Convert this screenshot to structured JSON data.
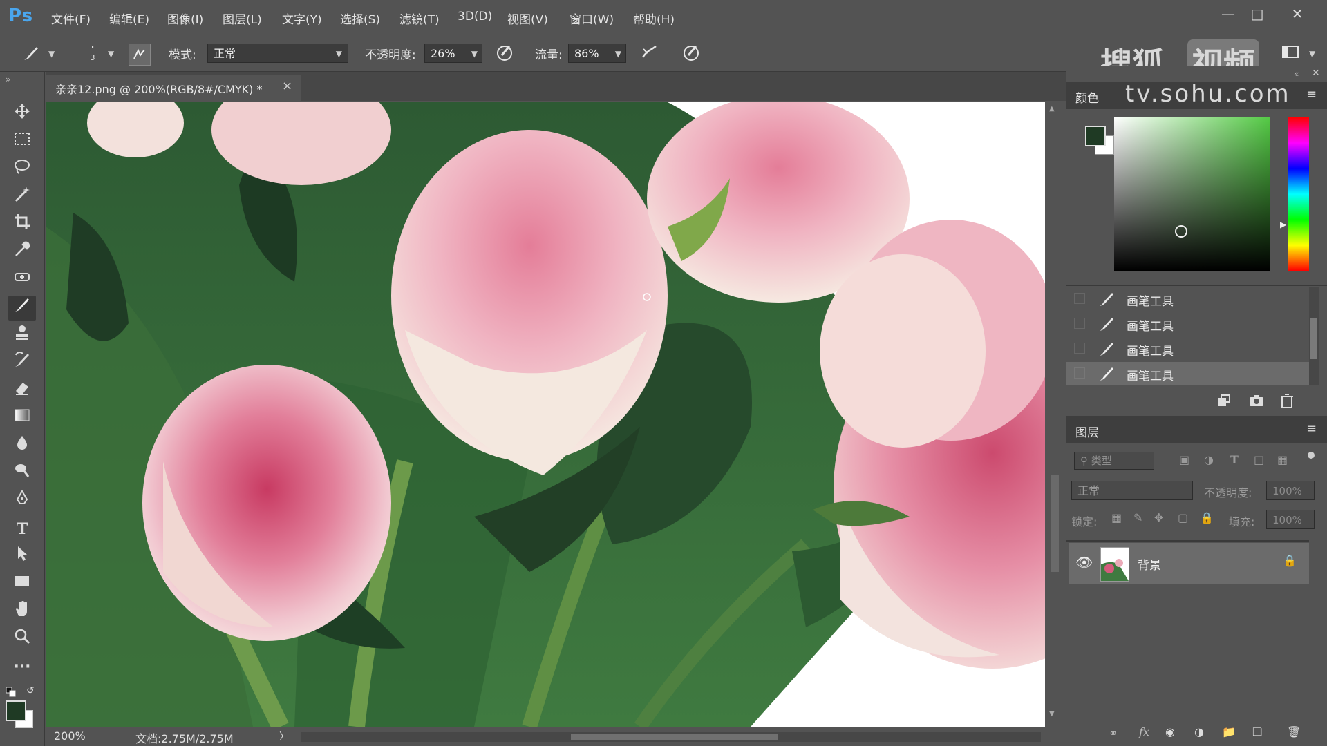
{
  "app": {
    "logo": "Ps"
  },
  "menu": [
    "文件(F)",
    "编辑(E)",
    "图像(I)",
    "图层(L)",
    "文字(Y)",
    "选择(S)",
    "滤镜(T)",
    "3D(D)",
    "视图(V)",
    "窗口(W)",
    "帮助(H)"
  ],
  "options": {
    "brush_size": "3",
    "mode_label": "模式:",
    "mode_value": "正常",
    "opacity_label": "不透明度:",
    "opacity_value": "26%",
    "flow_label": "流量:",
    "flow_value": "86%"
  },
  "watermark": {
    "brand": "搜狐",
    "video": "视频",
    "url": "tv.sohu.com"
  },
  "document": {
    "tab_title": "亲亲12.png @ 200%(RGB/8#/CMYK) *",
    "close": "×"
  },
  "status": {
    "zoom": "200%",
    "doc_size": "文档:2.75M/2.75M",
    "arrow": "〉"
  },
  "colors": {
    "foreground": "#1f3a24",
    "background": "#ffffff",
    "accent": "#4aa6ee",
    "picker_hue": "#53c944"
  },
  "color_panel": {
    "title": "颜色"
  },
  "history_panel": {
    "items": [
      {
        "label": "画笔工具",
        "icon": "brush-icon"
      },
      {
        "label": "画笔工具",
        "icon": "brush-icon"
      },
      {
        "label": "画笔工具",
        "icon": "brush-icon"
      },
      {
        "label": "画笔工具",
        "icon": "brush-icon"
      }
    ]
  },
  "layers_panel": {
    "title": "图层",
    "filter_placeholder": "类型",
    "blend_mode": "正常",
    "opacity_label": "不透明度:",
    "opacity_value": "100%",
    "lock_label": "锁定:",
    "fill_label": "填充:",
    "fill_value": "100%",
    "layers": [
      {
        "name": "背景",
        "visible": true,
        "locked": true
      }
    ]
  },
  "tools": [
    "move-icon",
    "marquee-icon",
    "lasso-icon",
    "magic-wand-icon",
    "crop-icon",
    "eyedropper-icon",
    "spot-heal-icon",
    "brush-icon",
    "stamp-icon",
    "history-brush-icon",
    "eraser-icon",
    "gradient-icon",
    "blur-icon",
    "dodge-icon",
    "pen-icon",
    "type-icon",
    "path-select-icon",
    "rectangle-icon",
    "hand-icon",
    "zoom-icon",
    "more-icon"
  ]
}
